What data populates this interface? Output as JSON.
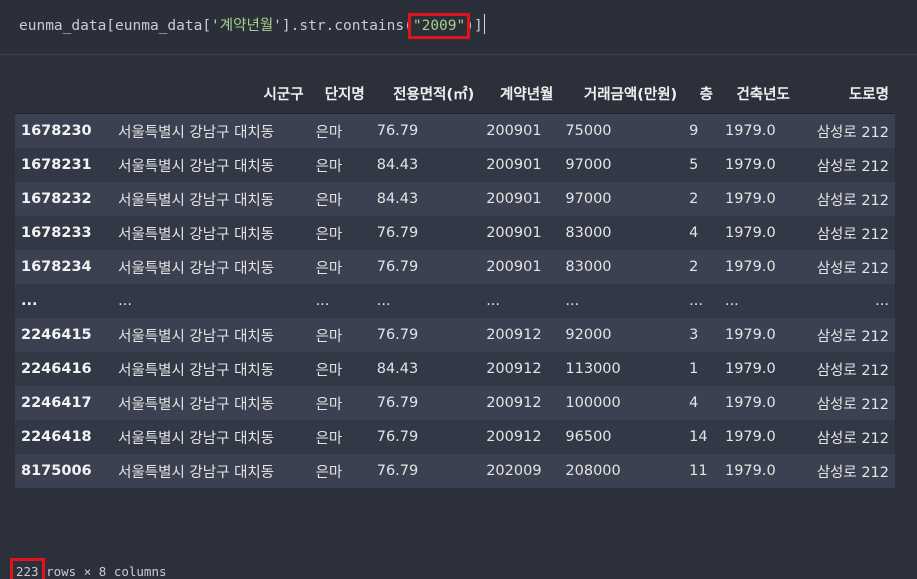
{
  "code": {
    "prefix": "eunma_data[eunma_data['",
    "column_key": "계약년월",
    "middle": "'].str.contains(",
    "arg": "\"2009\"",
    "suffix": ")]"
  },
  "table": {
    "columns": [
      "시군구",
      "단지명",
      "전용면적(㎡)",
      "계약년월",
      "거래금액(만원)",
      "층",
      "건축년도",
      "도로명"
    ],
    "rows": [
      {
        "index": "1678230",
        "cells": [
          "서울특별시 강남구 대치동",
          "은마",
          "76.79",
          "200901",
          "75000",
          "9",
          "1979.0",
          "삼성로 212"
        ]
      },
      {
        "index": "1678231",
        "cells": [
          "서울특별시 강남구 대치동",
          "은마",
          "84.43",
          "200901",
          "97000",
          "5",
          "1979.0",
          "삼성로 212"
        ]
      },
      {
        "index": "1678232",
        "cells": [
          "서울특별시 강남구 대치동",
          "은마",
          "84.43",
          "200901",
          "97000",
          "2",
          "1979.0",
          "삼성로 212"
        ]
      },
      {
        "index": "1678233",
        "cells": [
          "서울특별시 강남구 대치동",
          "은마",
          "76.79",
          "200901",
          "83000",
          "4",
          "1979.0",
          "삼성로 212"
        ]
      },
      {
        "index": "1678234",
        "cells": [
          "서울특별시 강남구 대치동",
          "은마",
          "76.79",
          "200901",
          "83000",
          "2",
          "1979.0",
          "삼성로 212"
        ]
      },
      {
        "index": "...",
        "cells": [
          "...",
          "...",
          "...",
          "...",
          "...",
          "...",
          "...",
          "..."
        ]
      },
      {
        "index": "2246415",
        "cells": [
          "서울특별시 강남구 대치동",
          "은마",
          "76.79",
          "200912",
          "92000",
          "3",
          "1979.0",
          "삼성로 212"
        ]
      },
      {
        "index": "2246416",
        "cells": [
          "서울특별시 강남구 대치동",
          "은마",
          "84.43",
          "200912",
          "113000",
          "1",
          "1979.0",
          "삼성로 212"
        ]
      },
      {
        "index": "2246417",
        "cells": [
          "서울특별시 강남구 대치동",
          "은마",
          "76.79",
          "200912",
          "100000",
          "4",
          "1979.0",
          "삼성로 212"
        ]
      },
      {
        "index": "2246418",
        "cells": [
          "서울특별시 강남구 대치동",
          "은마",
          "76.79",
          "200912",
          "96500",
          "14",
          "1979.0",
          "삼성로 212"
        ]
      },
      {
        "index": "8175006",
        "cells": [
          "서울특별시 강남구 대치동",
          "은마",
          "76.79",
          "202009",
          "208000",
          "11",
          "1979.0",
          "삼성로 212"
        ]
      }
    ]
  },
  "footer": {
    "row_count": "223",
    "rest": " rows × 8 columns"
  },
  "colors": {
    "background": "#2b303b",
    "highlight_box": "#e0141b",
    "string_token": "#a6d189"
  }
}
